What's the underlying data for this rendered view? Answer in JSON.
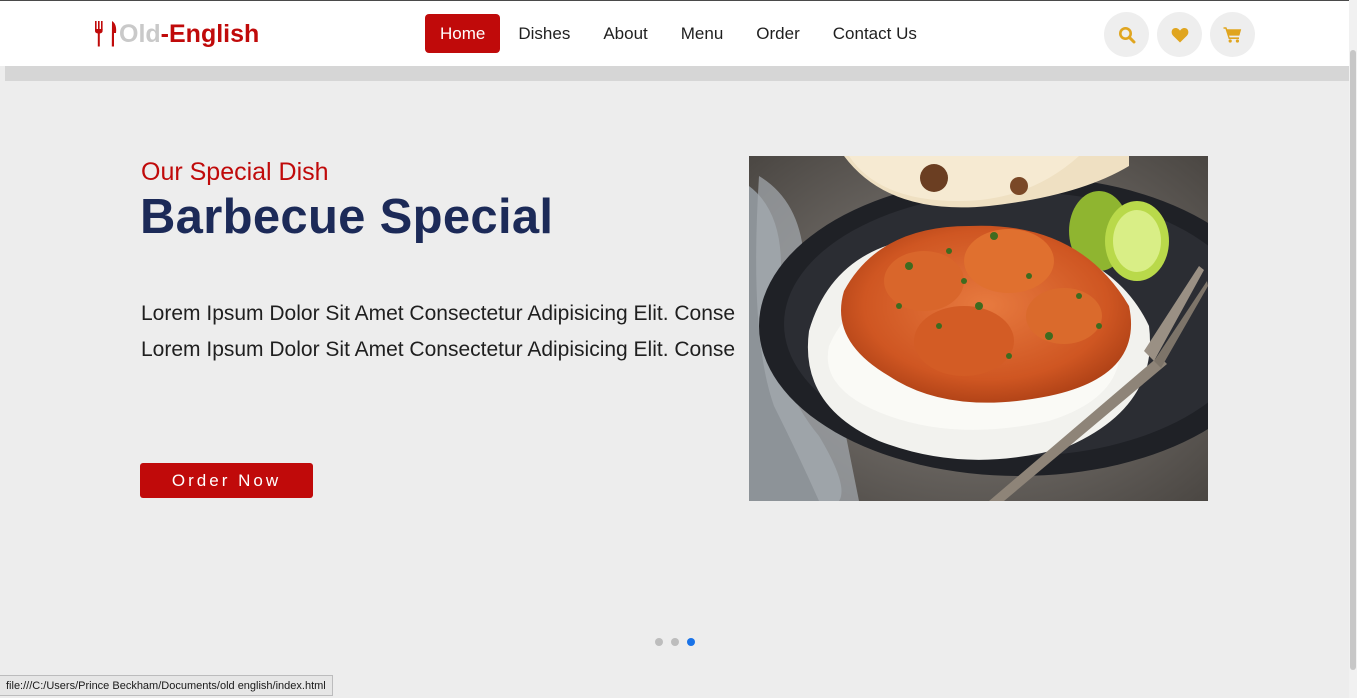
{
  "header": {
    "logo": {
      "part1": "Old",
      "dash": "-",
      "part2": "English",
      "icon": "utensils-icon"
    },
    "nav": [
      {
        "label": "Home",
        "active": true
      },
      {
        "label": "Dishes",
        "active": false
      },
      {
        "label": "About",
        "active": false
      },
      {
        "label": "Menu",
        "active": false
      },
      {
        "label": "Order",
        "active": false
      },
      {
        "label": "Contact Us",
        "active": false
      }
    ],
    "icons": [
      "search-icon",
      "heart-icon",
      "cart-icon"
    ]
  },
  "hero": {
    "subtitle": "Our Special Dish",
    "title": "Barbecue Special",
    "text": "Lorem Ipsum Dolor Sit Amet Consectetur Adipisicing Elit. Conse Lorem Ipsum Dolor Sit Amet Consectetur Adipisicing Elit. Conse",
    "button": "Order Now"
  },
  "slider": {
    "count": 3,
    "active_index": 2
  },
  "status": {
    "url": "file:///C:/Users/Prince Beckham/Documents/old english/index.html"
  },
  "colors": {
    "brand_red": "#c00a0a",
    "title_navy": "#1c2a58",
    "icon_gold": "#e0a51f",
    "dot_active": "#1a73e8"
  }
}
